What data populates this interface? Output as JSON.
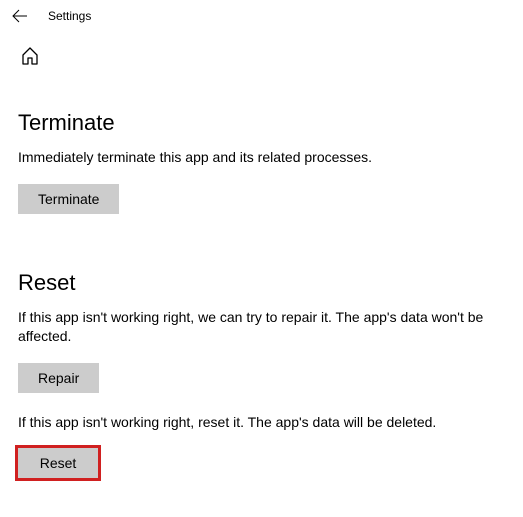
{
  "header": {
    "title": "Settings"
  },
  "sections": {
    "terminate": {
      "title": "Terminate",
      "desc": "Immediately terminate this app and its related processes.",
      "button_label": "Terminate"
    },
    "reset": {
      "title": "Reset",
      "repair_desc": "If this app isn't working right, we can try to repair it. The app's data won't be affected.",
      "repair_button_label": "Repair",
      "reset_desc": "If this app isn't working right, reset it. The app's data will be deleted.",
      "reset_button_label": "Reset"
    }
  }
}
